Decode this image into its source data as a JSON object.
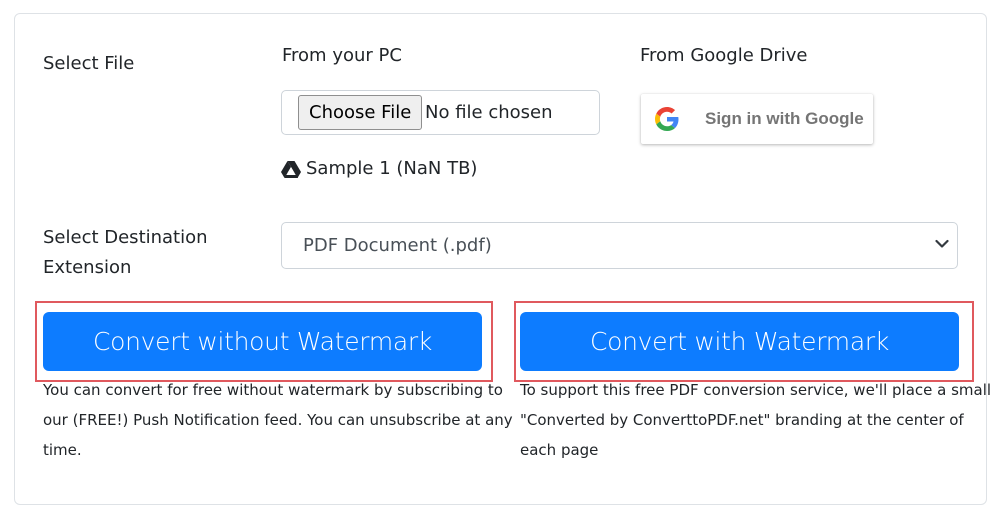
{
  "labels": {
    "select_file": "Select File",
    "from_pc": "From your PC",
    "from_drive": "From Google Drive",
    "dest_line1": "Select Destination",
    "dest_line2": "Extension"
  },
  "file_input": {
    "button_label": "Choose File",
    "status": "No file chosen"
  },
  "drive_file": {
    "name": "Sample 1 (NaN TB)",
    "icon": "google-drive-icon"
  },
  "google_signin": {
    "label": "Sign in with Google",
    "icon": "google-g-logo-icon"
  },
  "destination": {
    "selected": "PDF Document (.pdf)"
  },
  "buttons": {
    "without_watermark": "Convert without Watermark",
    "with_watermark": "Convert with Watermark"
  },
  "notes": {
    "without_line1": "You can convert for free without watermark by subscribing to",
    "without_line2": "our (FREE!) Push Notification feed. You can unsubscribe at any",
    "without_line3": "time.",
    "with_line1": "To support this free PDF conversion service, we'll place a small",
    "with_line2": "\"Converted by ConverttoPDF.net\" branding at the center of",
    "with_line3": "each page"
  },
  "colors": {
    "primary": "#0d7cff",
    "highlight": "#e0595e"
  }
}
